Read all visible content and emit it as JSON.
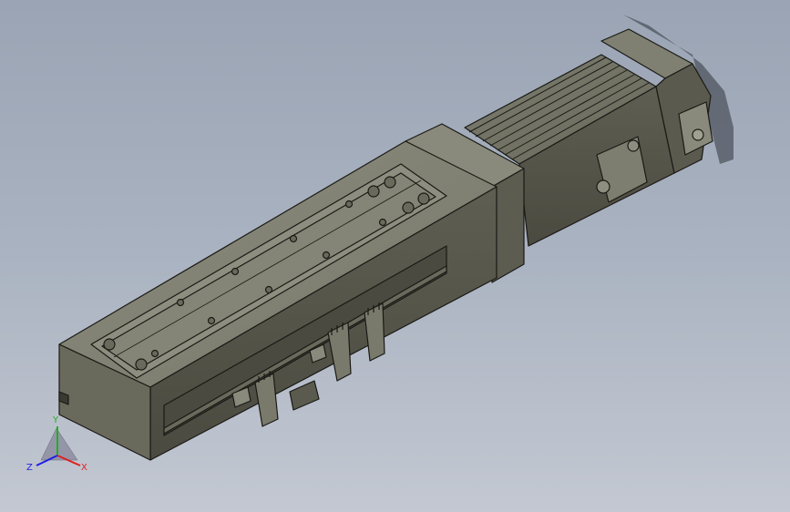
{
  "viewport": {
    "background_top": "#9aa4b4",
    "background_bottom": "#c3c8d2",
    "model_color": "#6e6e60",
    "edge_color": "#1a1a16"
  },
  "triad": {
    "x_label": "X",
    "y_label": "Y",
    "z_label": "Z",
    "x_color": "#e02020",
    "y_color": "#20b020",
    "z_color": "#2020e0"
  }
}
